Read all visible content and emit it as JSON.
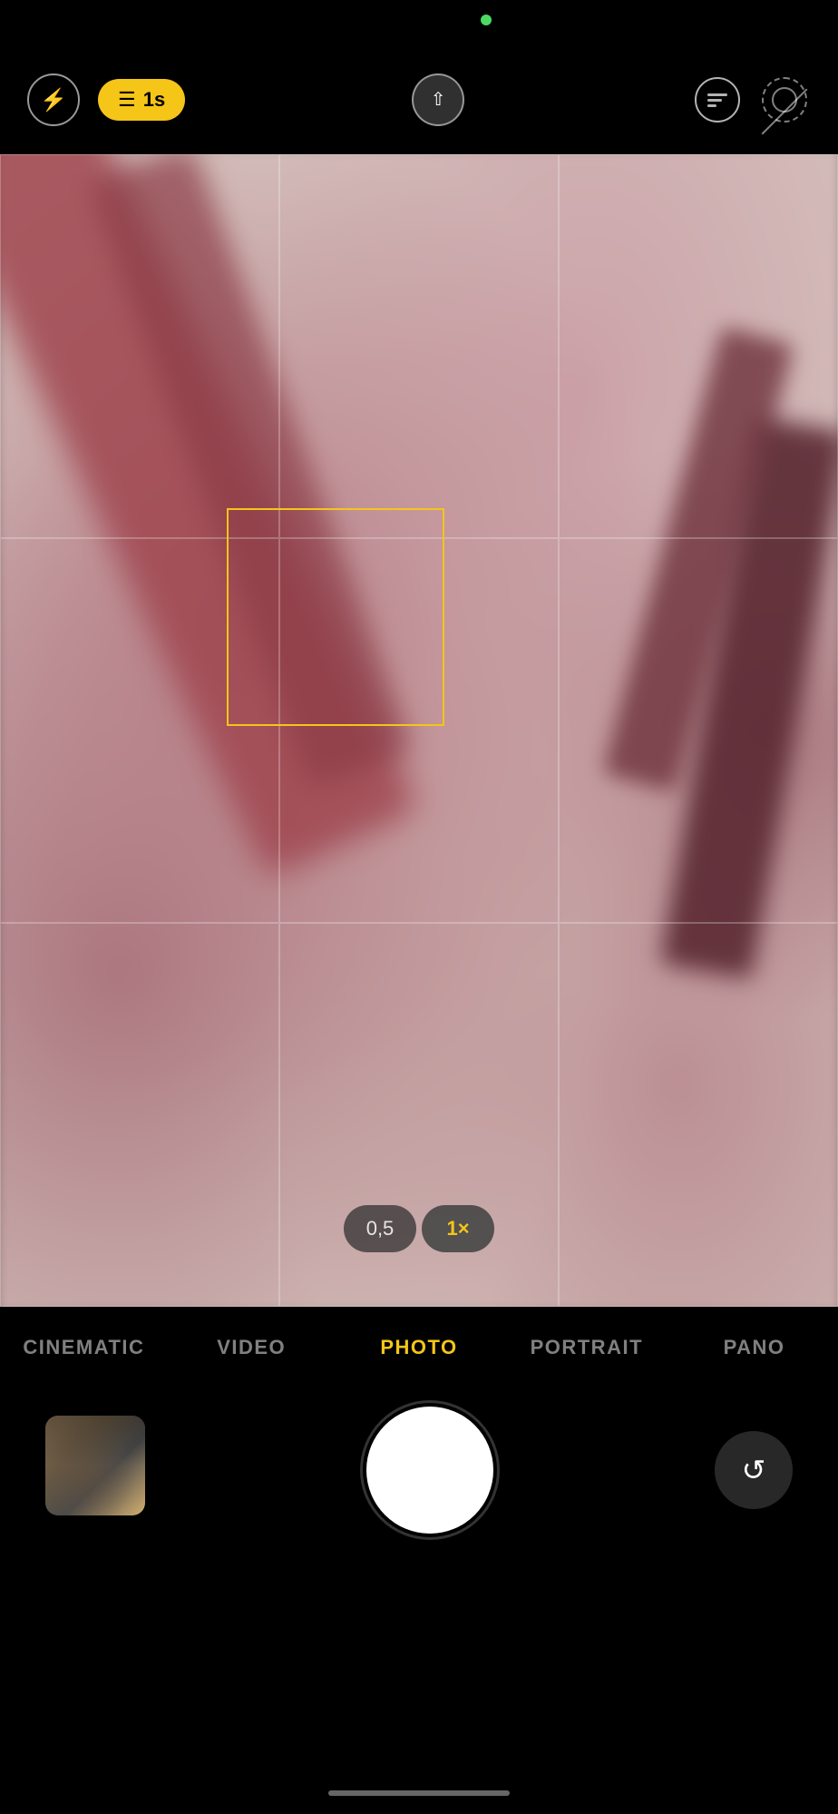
{
  "statusBar": {
    "indicator_color": "#4cd964"
  },
  "topControls": {
    "flashLabel": "⚡",
    "timerValue": "1s",
    "chevronLabel": "∧",
    "livePhotoLabel": "live",
    "noPhotoLabel": "no-photo"
  },
  "viewfinder": {
    "focusBoxVisible": true
  },
  "zoomControls": {
    "options": [
      {
        "value": "0,5",
        "label": "0,5",
        "active": false
      },
      {
        "value": "1x",
        "label": "1×",
        "active": true
      }
    ]
  },
  "modes": [
    {
      "id": "cinematic",
      "label": "CINEMATIC",
      "active": false
    },
    {
      "id": "video",
      "label": "VIDEO",
      "active": false
    },
    {
      "id": "photo",
      "label": "PHOTO",
      "active": true
    },
    {
      "id": "portrait",
      "label": "PORTRAIT",
      "active": false
    },
    {
      "id": "pano",
      "label": "PANO",
      "active": false
    }
  ],
  "bottomControls": {
    "shutterLabel": "",
    "rotateLabel": "↺"
  }
}
